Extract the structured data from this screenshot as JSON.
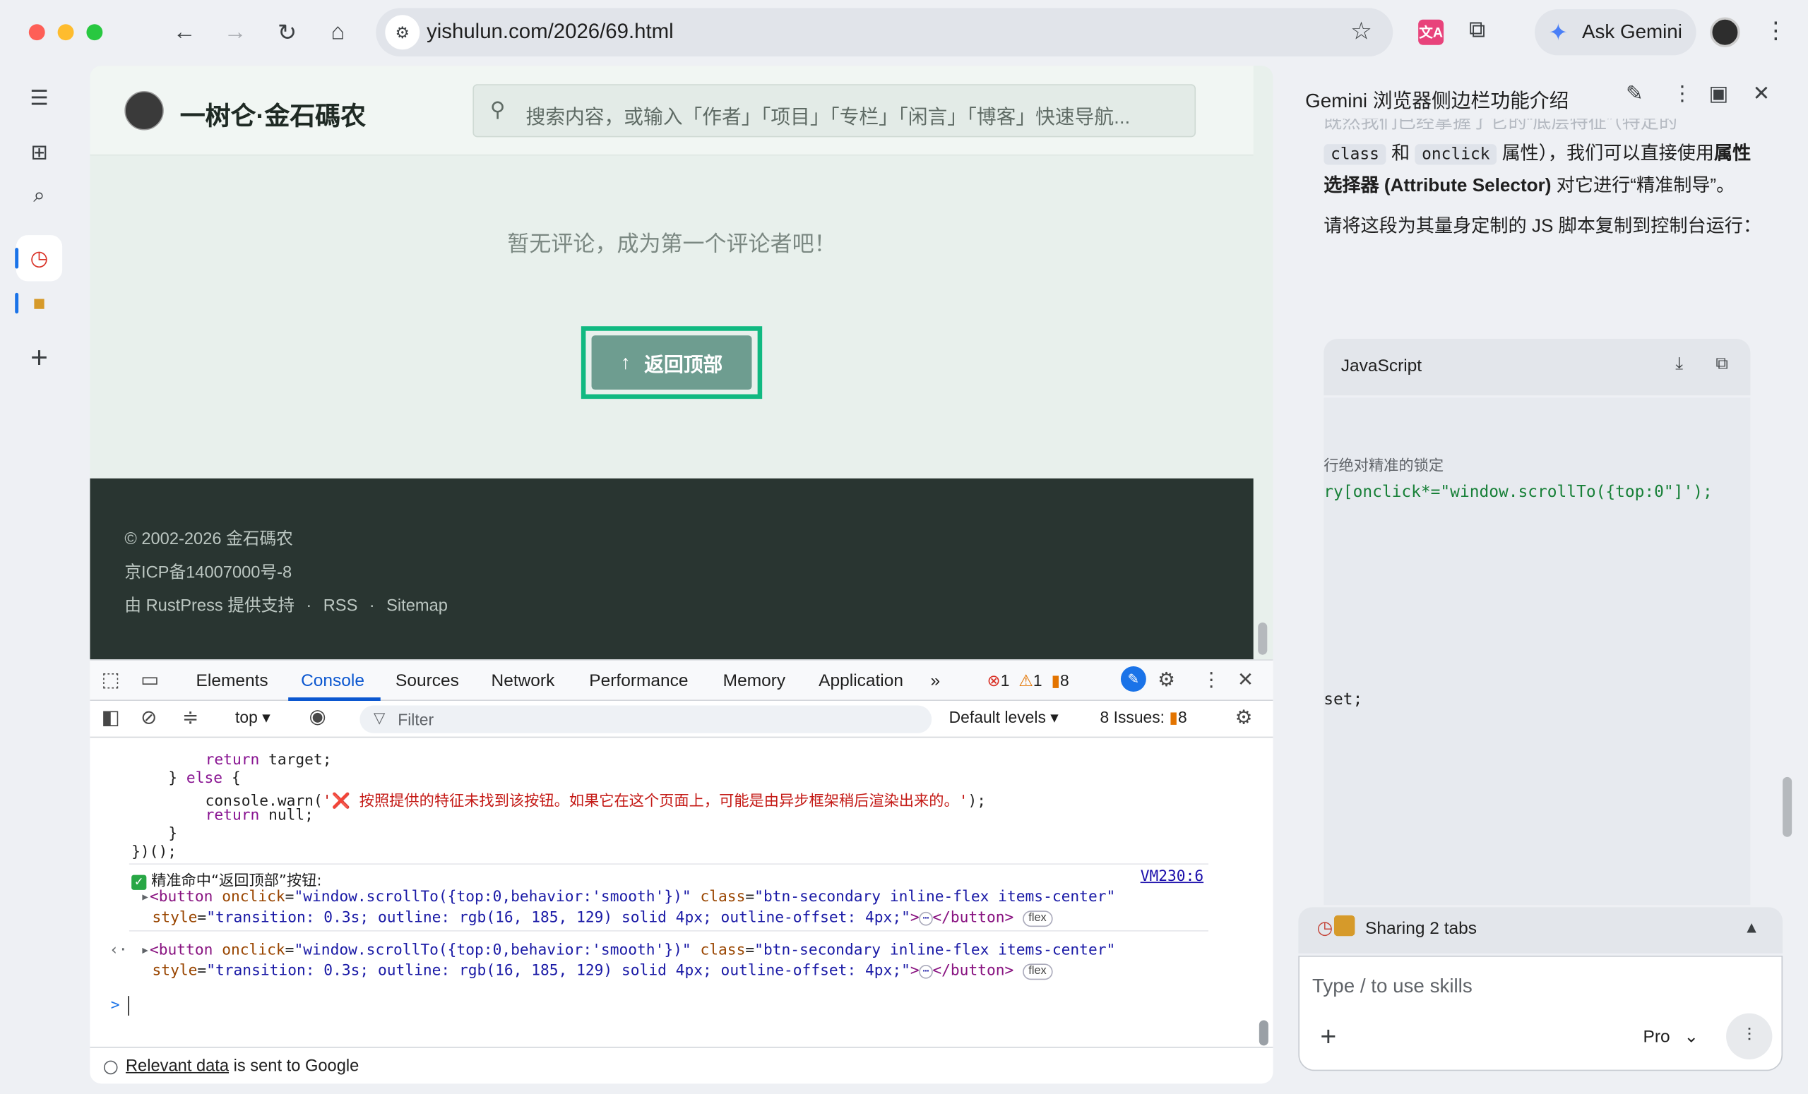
{
  "browser": {
    "url": "yishulun.com/2026/69.html",
    "gemini_label": "Ask Gemini",
    "translate_icon_text": "文A"
  },
  "page": {
    "site_name": "一树仑·金石碼农",
    "search_placeholder": "搜索内容，或输入「作者」「项目」「专栏」「闲言」「博客」快速导航...",
    "no_comment": "暂无评论，成为第一个评论者吧！",
    "back_to_top": "返回顶部",
    "footer_copyright": "© 2002-2026 金石碼农",
    "footer_icp": "京ICP备14007000号-8",
    "footer_powered": "由 RustPress 提供支持",
    "footer_dot": "·",
    "footer_rss": "RSS",
    "footer_sitemap": "Sitemap"
  },
  "devtools": {
    "tabs": [
      "Elements",
      "Console",
      "Sources",
      "Network",
      "Performance",
      "Memory",
      "Application"
    ],
    "more_tabs": "»",
    "errors": "1",
    "warnings": "1",
    "issues_count": "8",
    "context": "top",
    "filter_placeholder": "Filter",
    "levels": "Default levels",
    "issues_label": "8 Issues:",
    "issues_badge": "8",
    "console": {
      "line1_a": "return",
      "line1_b": " target;",
      "line2_a": "} ",
      "line2_b": "else",
      "line2_c": " {",
      "line3_a": "console.warn(",
      "line3_b": "'❌ 按照提供的特征未找到该按钮。如果它在这个页面上，可能是由异步框架稍后渲染出来的。'",
      "line3_c": ");",
      "line4_a": "return",
      "line4_b": " null;",
      "line5": "}",
      "line6": "})();",
      "log_badge": "✓",
      "log_text": "精准命中“返回顶部”按钮:",
      "log_source": "VM230:6",
      "el_open": "<button",
      "el_attr1": " onclick",
      "el_eq": "=",
      "el_val1": "\"window.scrollTo({top:0,behavior:'smooth'})\"",
      "el_attr2": " class",
      "el_val2": "\"btn-secondary inline-flex items-center\"",
      "el_attr3": "style",
      "el_val3": "\"transition: 0.3s; outline: rgb(16, 185, 129) solid 4px; outline-offset: 4px;\"",
      "el_close_open": ">",
      "el_ellipsis": "⋯",
      "el_close": "</button>",
      "el_pill": "flex",
      "return_arrow": "‹·",
      "prompt": ">"
    },
    "footer_link": "Relevant data",
    "footer_text": " is sent to Google"
  },
  "side": {
    "title": "Gemini 浏览器侧边栏功能介绍",
    "faded_top": "既然我们已经掌握了它的“底层特征”（特定的",
    "code_class": "class",
    "and_text": " 和 ",
    "code_onclick": "onclick",
    "after_attrs": " 属性），我们可以直接使",
    "p1_pre": "用",
    "p1_bold": "属性选择器 (Attribute Selector)",
    "p1_post": " 对它进行“精准制导”。",
    "p2": "请将这段为其量身定制的 JS 脚本复制到控制台运行：",
    "code_lang": "JavaScript",
    "code_comment": "行绝对精准的锁定",
    "code_line2": "ry[onclick*=\"window.scrollTo({top:0\"]');",
    "code_line3": "set;",
    "sharing": "Sharing 2 tabs",
    "input_placeholder": "Type / to use skills",
    "model": "Pro"
  },
  "colors": {
    "accent_green": "#10b981",
    "footer_bg": "#293531",
    "button_bg": "#6e9d90",
    "devtools_blue": "#0b57d0"
  }
}
